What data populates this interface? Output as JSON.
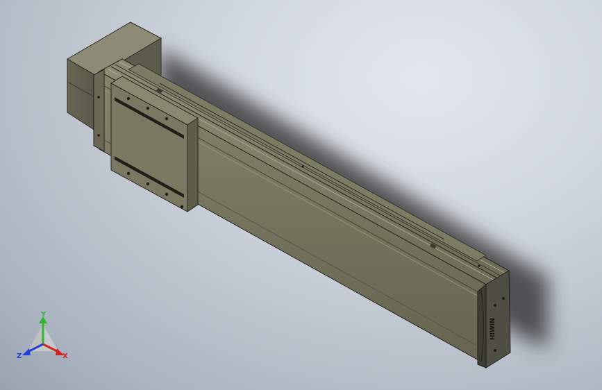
{
  "viewport": {
    "background_top": "#dde2e9",
    "background_bottom": "#9aa3b0"
  },
  "model": {
    "name": "linear-actuator",
    "body_color": "#727059",
    "end_cap_color": "#4e4e42",
    "logo_text": "HIWIN"
  },
  "triad": {
    "x_label": "X",
    "y_label": "Y",
    "z_label": "Z",
    "x_color": "#d62020",
    "y_color": "#2fb52f",
    "z_color": "#2040d8"
  }
}
